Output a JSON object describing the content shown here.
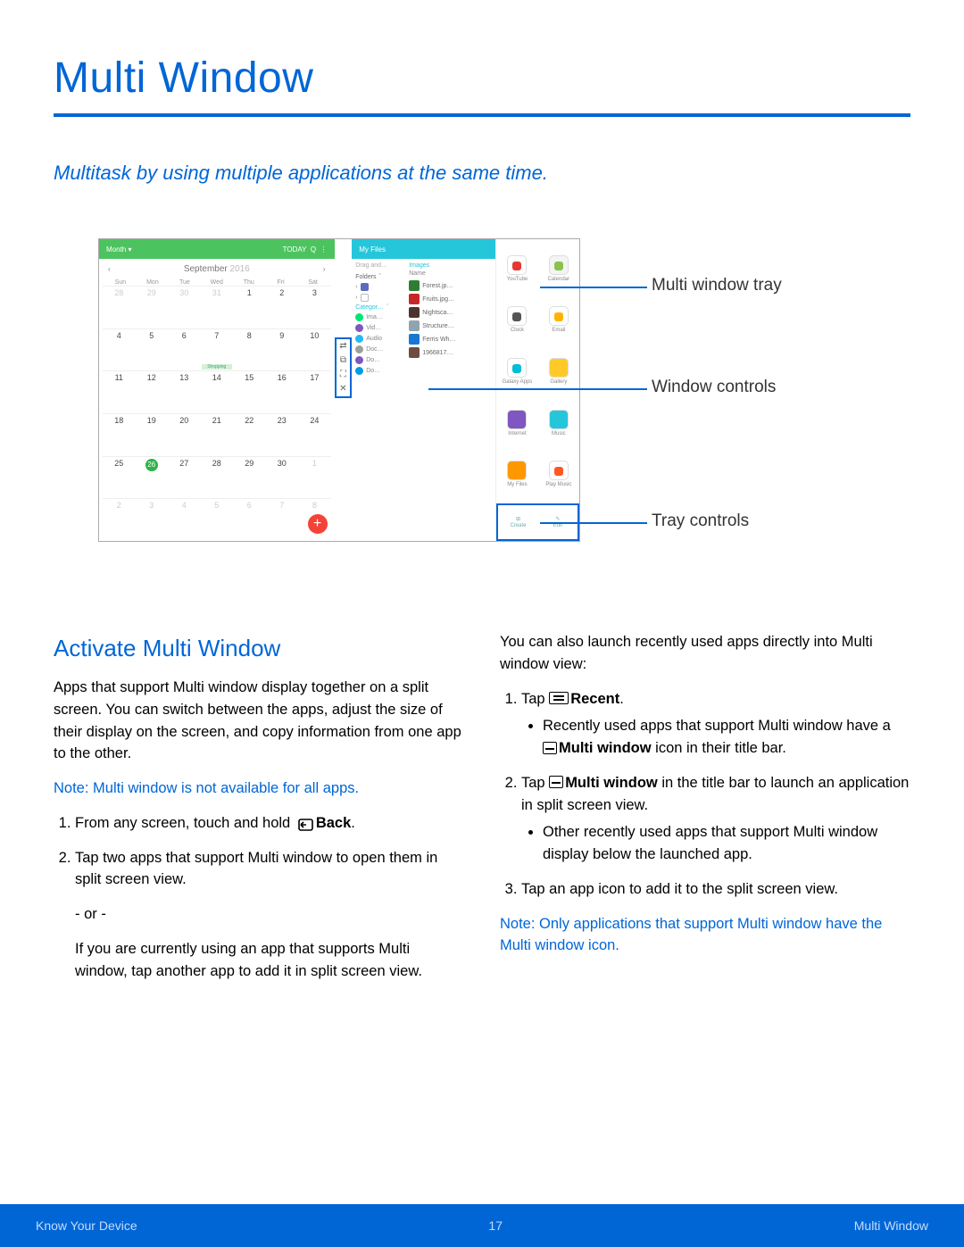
{
  "page": {
    "title": "Multi Window",
    "subtitle": "Multitask by using multiple applications at the same time."
  },
  "diagram": {
    "calendar": {
      "viewLabel": "Month",
      "today": "TODAY",
      "monthLabel": "September",
      "year": "2016",
      "dow": [
        "Sun",
        "Mon",
        "Tue",
        "Wed",
        "Thu",
        "Fri",
        "Sat"
      ],
      "eventLabel": "Shopping"
    },
    "controls": [
      "⇄",
      "⧉",
      "⛶",
      "✕"
    ],
    "files": {
      "title": "My Files",
      "dragLabel": "Drag and…",
      "imagesTab": "Images",
      "foldersLabel": "Folders",
      "nameHeader": "Name",
      "categoriesLabel": "Categor…",
      "leftItems": [
        "Ima…",
        "Vid…",
        "Audio",
        "Doc…",
        "Do…",
        "Do…"
      ],
      "rightItems": [
        "Forest.jp…",
        "Fruits.jpg…",
        "Nightsca…",
        "Structure…",
        "Ferris Wh…",
        "1966817…"
      ]
    },
    "tray": {
      "apps": [
        {
          "label": "YouTube",
          "bg": "#fff",
          "dot": "#e53935"
        },
        {
          "label": "Calendar",
          "bg": "#f4f4f4",
          "dot": "#8bc34a"
        },
        {
          "label": "Clock",
          "bg": "#fff",
          "dot": "#555"
        },
        {
          "label": "Email",
          "bg": "#fff",
          "dot": "#ffb300"
        },
        {
          "label": "Galaxy Apps",
          "bg": "#fff",
          "dot": "#00bcd4"
        },
        {
          "label": "Gallery",
          "bg": "#ffca28",
          "dot": "#ffca28"
        },
        {
          "label": "Internet",
          "bg": "#7e57c2",
          "dot": "#7e57c2"
        },
        {
          "label": "Music",
          "bg": "#26c6da",
          "dot": "#26c6da"
        },
        {
          "label": "My Files",
          "bg": "#ff9800",
          "dot": "#ff9800"
        },
        {
          "label": "Play Music",
          "bg": "#fff",
          "dot": "#ff5722"
        }
      ],
      "controls": {
        "create": "Create",
        "edit": "Edit"
      }
    },
    "callouts": {
      "trayLabel": "Multi window tray",
      "controlsLabel": "Window controls",
      "trayControlsLabel": "Tray controls"
    }
  },
  "body": {
    "sectionHead": "Activate Multi Window",
    "intro": "Apps that support Multi window display together on a split screen. You can switch between the apps, adjust the size of their display on the screen, and copy information from one app to the other.",
    "note1": "Note: Multi window is not available for all apps.",
    "step1a": "From any screen, touch and hold ",
    "step1b": "Back",
    "step1c": ".",
    "step2": "Tap two apps that support Multi window to open them in split screen view.",
    "orLabel": "- or -",
    "orText": "If you are currently using an app that supports Multi window, tap another app to add it in split screen view.",
    "rightIntro": "You can also launch recently used apps directly into Multi window view:",
    "rstep1a": "Tap ",
    "rstep1b": "Recent",
    "rstep1c": ".",
    "rbullet1a": "Recently used apps that support Multi window have a ",
    "rbullet1b": "Multi window",
    "rbullet1c": " icon in their title bar.",
    "rstep2a": "Tap ",
    "rstep2b": "Multi window",
    "rstep2c": " in the title bar to launch an application in split screen view.",
    "rbullet2": "Other recently used apps that support Multi window display below the launched app.",
    "rstep3": "Tap an app icon to add it to the split screen view.",
    "note2": "Note: Only applications that support Multi window have the Multi window icon."
  },
  "footer": {
    "left": "Know Your Device",
    "page": "17",
    "right": "Multi Window"
  }
}
